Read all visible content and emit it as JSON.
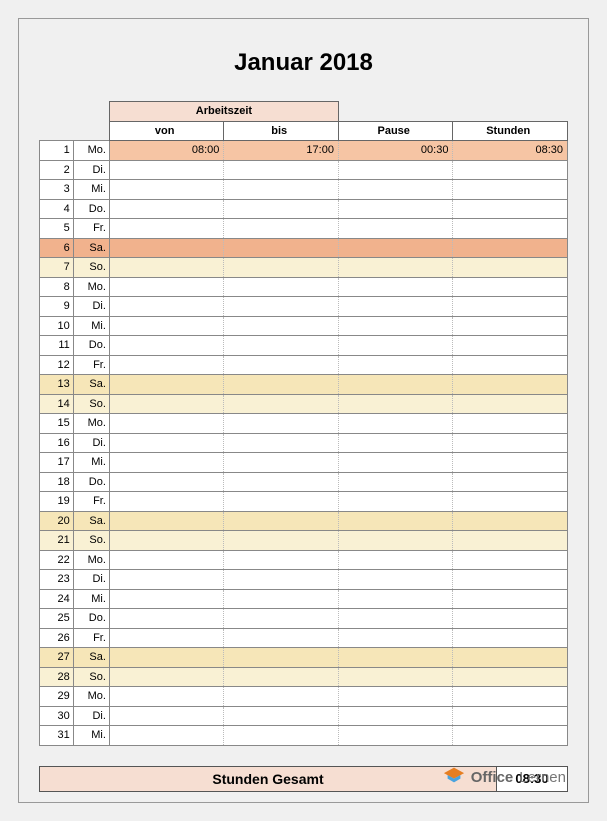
{
  "title": "Januar 2018",
  "headers": {
    "arbeitszeit": "Arbeitszeit",
    "von": "von",
    "bis": "bis",
    "pause": "Pause",
    "stunden": "Stunden"
  },
  "days": [
    {
      "n": "1",
      "d": "Mo.",
      "von": "08:00",
      "bis": "17:00",
      "pause": "00:30",
      "stunden": "08:30",
      "cls": "row-first"
    },
    {
      "n": "2",
      "d": "Di.",
      "cls": "row-normal"
    },
    {
      "n": "3",
      "d": "Mi.",
      "cls": "row-normal"
    },
    {
      "n": "4",
      "d": "Do.",
      "cls": "row-normal"
    },
    {
      "n": "5",
      "d": "Fr.",
      "cls": "row-normal"
    },
    {
      "n": "6",
      "d": "Sa.",
      "cls": "row-sat6"
    },
    {
      "n": "7",
      "d": "So.",
      "cls": "row-sun"
    },
    {
      "n": "8",
      "d": "Mo.",
      "cls": "row-normal"
    },
    {
      "n": "9",
      "d": "Di.",
      "cls": "row-normal"
    },
    {
      "n": "10",
      "d": "Mi.",
      "cls": "row-normal"
    },
    {
      "n": "11",
      "d": "Do.",
      "cls": "row-normal"
    },
    {
      "n": "12",
      "d": "Fr.",
      "cls": "row-normal"
    },
    {
      "n": "13",
      "d": "Sa.",
      "cls": "row-sat"
    },
    {
      "n": "14",
      "d": "So.",
      "cls": "row-sun"
    },
    {
      "n": "15",
      "d": "Mo.",
      "cls": "row-normal"
    },
    {
      "n": "16",
      "d": "Di.",
      "cls": "row-normal"
    },
    {
      "n": "17",
      "d": "Mi.",
      "cls": "row-normal"
    },
    {
      "n": "18",
      "d": "Do.",
      "cls": "row-normal"
    },
    {
      "n": "19",
      "d": "Fr.",
      "cls": "row-normal"
    },
    {
      "n": "20",
      "d": "Sa.",
      "cls": "row-sat"
    },
    {
      "n": "21",
      "d": "So.",
      "cls": "row-sun"
    },
    {
      "n": "22",
      "d": "Mo.",
      "cls": "row-normal"
    },
    {
      "n": "23",
      "d": "Di.",
      "cls": "row-normal"
    },
    {
      "n": "24",
      "d": "Mi.",
      "cls": "row-normal"
    },
    {
      "n": "25",
      "d": "Do.",
      "cls": "row-normal"
    },
    {
      "n": "26",
      "d": "Fr.",
      "cls": "row-normal"
    },
    {
      "n": "27",
      "d": "Sa.",
      "cls": "row-sat"
    },
    {
      "n": "28",
      "d": "So.",
      "cls": "row-sun"
    },
    {
      "n": "29",
      "d": "Mo.",
      "cls": "row-normal"
    },
    {
      "n": "30",
      "d": "Di.",
      "cls": "row-normal"
    },
    {
      "n": "31",
      "d": "Mi.",
      "cls": "row-normal"
    }
  ],
  "total": {
    "label": "Stunden Gesamt",
    "value": "08:30"
  },
  "brand": {
    "word1": "Office",
    "word2": "Lernen"
  }
}
